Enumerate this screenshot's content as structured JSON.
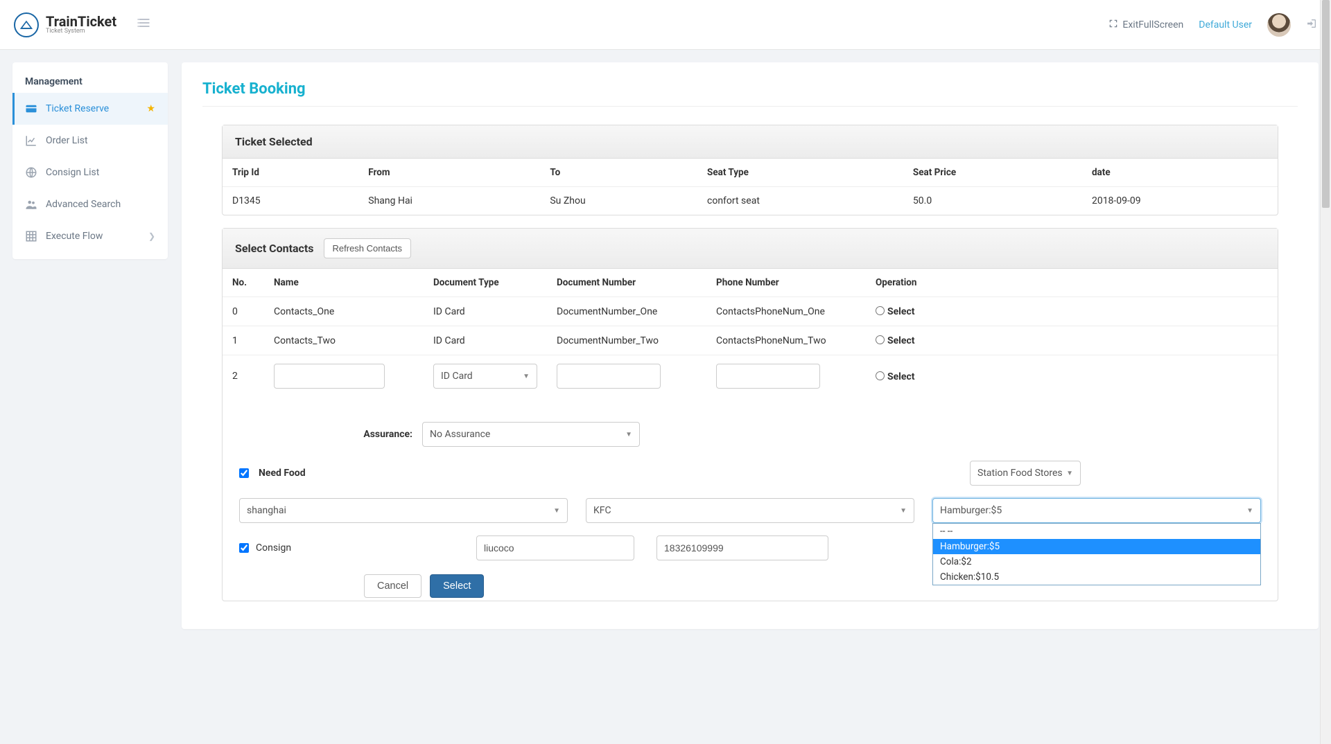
{
  "header": {
    "brand_title": "TrainTicket",
    "brand_sub": "Ticket System",
    "exit_fullscreen": "ExitFullScreen",
    "user_name": "Default User"
  },
  "sidebar": {
    "section": "Management",
    "items": [
      {
        "label": "Ticket Reserve",
        "icon": "card",
        "active": true,
        "star": true
      },
      {
        "label": "Order List",
        "icon": "chart"
      },
      {
        "label": "Consign List",
        "icon": "globe"
      },
      {
        "label": "Advanced Search",
        "icon": "users"
      },
      {
        "label": "Execute Flow",
        "icon": "grid",
        "chev": true
      }
    ]
  },
  "page": {
    "title": "Ticket Booking"
  },
  "ticket_selected": {
    "title": "Ticket Selected",
    "headers": [
      "Trip Id",
      "From",
      "To",
      "Seat Type",
      "Seat Price",
      "date"
    ],
    "row": {
      "trip_id": "D1345",
      "from": "Shang Hai",
      "to": "Su Zhou",
      "seat_type": "confort seat",
      "seat_price": "50.0",
      "date": "2018-09-09"
    }
  },
  "contacts": {
    "title": "Select Contacts",
    "refresh_label": "Refresh Contacts",
    "headers": [
      "No.",
      "Name",
      "Document Type",
      "Document Number",
      "Phone Number",
      "Operation"
    ],
    "rows": [
      {
        "no": "0",
        "name": "Contacts_One",
        "doc_type": "ID Card",
        "doc_no": "DocumentNumber_One",
        "phone": "ContactsPhoneNum_One",
        "op": "Select"
      },
      {
        "no": "1",
        "name": "Contacts_Two",
        "doc_type": "ID Card",
        "doc_no": "DocumentNumber_Two",
        "phone": "ContactsPhoneNum_Two",
        "op": "Select"
      }
    ],
    "input_row": {
      "no": "2",
      "doc_type_selected": "ID Card",
      "op": "Select"
    }
  },
  "assurance": {
    "label": "Assurance:",
    "selected": "No Assurance"
  },
  "food": {
    "need_label": "Need Food",
    "source_selected": "Station Food Stores",
    "city_selected": "shanghai",
    "store_selected": "KFC",
    "item_selected": "Hamburger:$5",
    "item_options": [
      "-- --",
      "Hamburger:$5",
      "Cola:$2",
      "Chicken:$10.5"
    ]
  },
  "consign": {
    "label": "Consign",
    "name_value": "liucoco",
    "phone_value": "18326109999"
  },
  "buttons": {
    "cancel": "Cancel",
    "select": "Select"
  }
}
